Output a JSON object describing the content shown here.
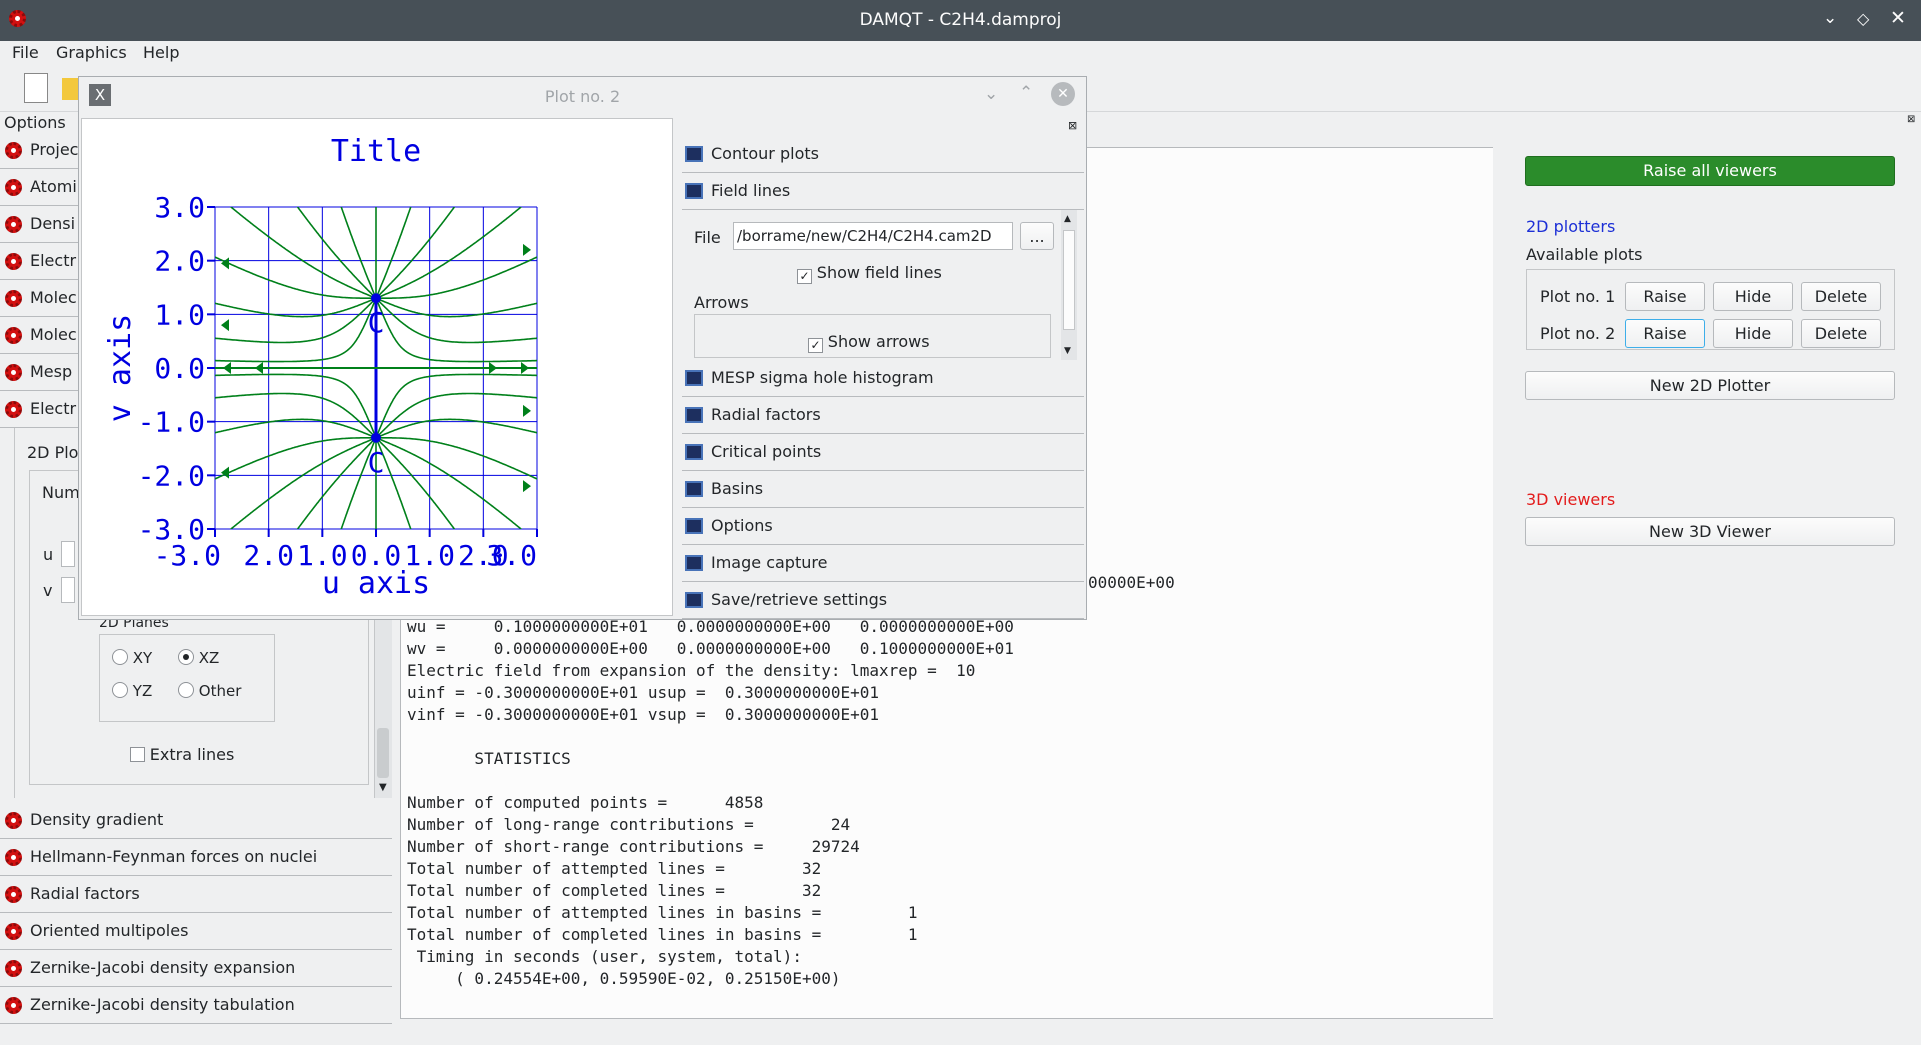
{
  "window": {
    "title": "DAMQT - C2H4.damproj"
  },
  "menu": [
    "File",
    "Graphics",
    "Help"
  ],
  "left": {
    "options_label": "Options",
    "tabs": [
      "Projec",
      "Atomi",
      "Densi",
      "Electr",
      "Molec",
      "Molec",
      "Mesp",
      "Electr"
    ],
    "sub_label": "2D Plo",
    "num_label": "Num",
    "u_label": "u",
    "v_label": "v",
    "planes_title": "2D Planes",
    "planes": [
      "XY",
      "XZ",
      "YZ",
      "Other"
    ],
    "selected_plane": "XZ",
    "extra_lines": "Extra lines",
    "bottom_tabs": [
      "Density gradient",
      "Hellmann-Feynman forces on nuclei",
      "Radial factors",
      "Oriented multipoles",
      "Zernike-Jacobi density expansion",
      "Zernike-Jacobi density tabulation"
    ]
  },
  "plot": {
    "window_title": "Plot no. 2",
    "chart_title": "Title",
    "xlabel": "u axis",
    "ylabel": "v axis",
    "atom_label": "C",
    "xticks": [
      "-3.0",
      "2.0",
      "1.0",
      "0.0",
      "1.0",
      "2.0",
      "3.0"
    ],
    "yticks": [
      "3.0",
      "2.0",
      "1.0",
      "0.0",
      "-1.0",
      "-2.0",
      "-3.0"
    ],
    "colors": {
      "axis": "#0000e0",
      "lines": "#00801a"
    }
  },
  "accordion": {
    "top": [
      "Contour plots",
      "Field lines"
    ],
    "file_label": "File",
    "file_value": "/borrame/new/C2H4/C2H4.cam2D",
    "browse": "...",
    "show_field_lines": "Show field lines",
    "arrows_label": "Arrows",
    "show_arrows": "Show arrows",
    "bottom": [
      "MESP sigma hole histogram",
      "Radial factors",
      "Critical points",
      "Basins",
      "Options",
      "Image capture",
      "Save/retrieve settings"
    ]
  },
  "output": {
    "line0": "00000E+00",
    "lines": [
      "wu =     0.1000000000E+01   0.0000000000E+00   0.0000000000E+00",
      "wv =     0.0000000000E+00   0.0000000000E+00   0.1000000000E+01",
      "Electric field from expansion of the density: lmaxrep =  10",
      "uinf = -0.3000000000E+01 usup =  0.3000000000E+01",
      "vinf = -0.3000000000E+01 vsup =  0.3000000000E+01",
      "",
      "       STATISTICS",
      "",
      "Number of computed points =      4858",
      "Number of long-range contributions =        24",
      "Number of short-range contributions =     29724",
      "Total number of attempted lines =        32",
      "Total number of completed lines =        32",
      "Total number of attempted lines in basins =         1",
      "Total number of completed lines in basins =         1",
      " Timing in seconds (user, system, total):",
      "     ( 0.24554E+00, 0.59590E-02, 0.25150E+00)"
    ]
  },
  "right": {
    "raise_all": "Raise all viewers",
    "plotters_title": "2D plotters",
    "available": "Available plots",
    "plots": [
      {
        "name": "Plot no. 1",
        "raise": "Raise",
        "hide": "Hide",
        "delete": "Delete"
      },
      {
        "name": "Plot no. 2",
        "raise": "Raise",
        "hide": "Hide",
        "delete": "Delete"
      }
    ],
    "new_2d": "New 2D Plotter",
    "viewers_title": "3D viewers",
    "new_3d": "New 3D Viewer"
  }
}
